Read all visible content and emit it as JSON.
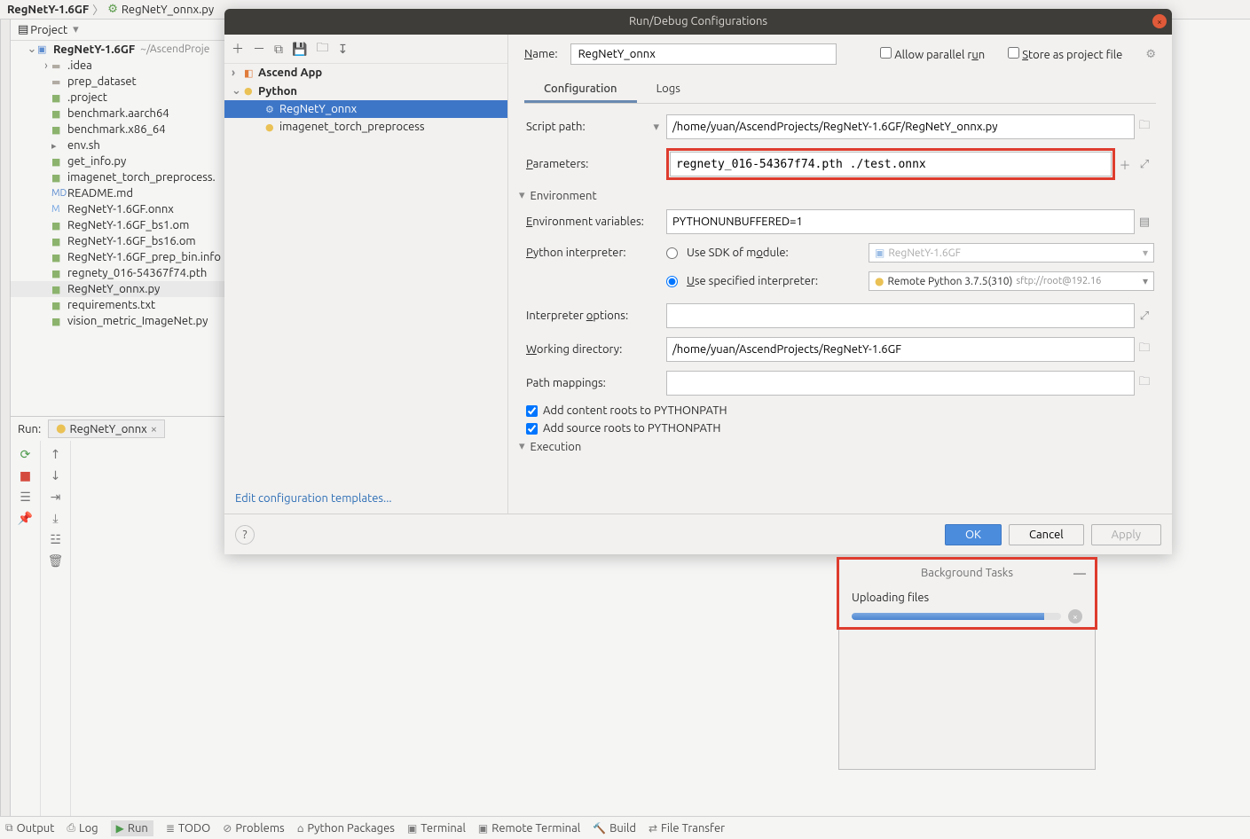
{
  "breadcrumb": {
    "root": "RegNetY-1.6GF",
    "sep": "〉",
    "file": "RegNetY_onnx.py"
  },
  "projectPanel": {
    "title": "Project",
    "rootName": "RegNetY-1.6GF",
    "rootPath": "~/AscendProje",
    "items": [
      ".idea",
      "prep_dataset",
      ".project",
      "benchmark.aarch64",
      "benchmark.x86_64",
      "env.sh",
      "get_info.py",
      "imagenet_torch_preprocess.",
      "README.md",
      "RegNetY-1.6GF.onnx",
      "RegNetY-1.6GF_bs1.om",
      "RegNetY-1.6GF_bs16.om",
      "RegNetY-1.6GF_prep_bin.info",
      "regnety_016-54367f74.pth",
      "RegNetY_onnx.py",
      "requirements.txt",
      "vision_metric_ImageNet.py"
    ],
    "selectedIndex": 14
  },
  "runStrip": {
    "label": "Run:",
    "tab": "RegNetY_onnx"
  },
  "bottom": [
    "Output",
    "Log",
    "Run",
    "TODO",
    "Problems",
    "Python Packages",
    "Terminal",
    "Remote Terminal",
    "Build",
    "File Transfer"
  ],
  "dialog": {
    "title": "Run/Debug Configurations",
    "name": {
      "label": "Name:",
      "value": "RegNetY_onnx"
    },
    "flags": {
      "parallel": "Allow parallel run",
      "store": "Store as project file"
    },
    "left": {
      "groups": [
        {
          "label": "Ascend App",
          "expanded": false,
          "children": []
        },
        {
          "label": "Python",
          "expanded": true,
          "children": [
            "RegNetY_onnx",
            "imagenet_torch_preprocess"
          ]
        }
      ],
      "selected": "RegNetY_onnx",
      "editLink": "Edit configuration templates..."
    },
    "tabs": [
      "Configuration",
      "Logs"
    ],
    "activeTab": 0,
    "form": {
      "scriptPath": {
        "label": "Script path:",
        "value": "/home/yuan/AscendProjects/RegNetY-1.6GF/RegNetY_onnx.py"
      },
      "parameters": {
        "label": "Parameters:",
        "value": "regnety_016-54367f74.pth ./test.onnx"
      },
      "envSection": "Environment",
      "envVars": {
        "label": "Environment variables:",
        "value": "PYTHONUNBUFFERED=1"
      },
      "pyInterp": {
        "label": "Python interpreter:",
        "sdkOpt": "Use SDK of module:",
        "sdkValue": "RegNetY-1.6GF",
        "specOpt": "Use specified interpreter:",
        "specValue": "Remote Python 3.7.5(310)",
        "specExtra": "sftp://root@192.16"
      },
      "interpOpts": {
        "label": "Interpreter options:",
        "value": ""
      },
      "workDir": {
        "label": "Working directory:",
        "value": "/home/yuan/AscendProjects/RegNetY-1.6GF"
      },
      "pathMap": {
        "label": "Path mappings:",
        "value": ""
      },
      "addContent": "Add content roots to PYTHONPATH",
      "addSource": "Add source roots to PYTHONPATH",
      "execSection": "Execution"
    },
    "buttons": {
      "ok": "OK",
      "cancel": "Cancel",
      "apply": "Apply",
      "help": "?"
    }
  },
  "bgtasks": {
    "title": "Background Tasks",
    "item": "Uploading files",
    "progress": 92
  }
}
